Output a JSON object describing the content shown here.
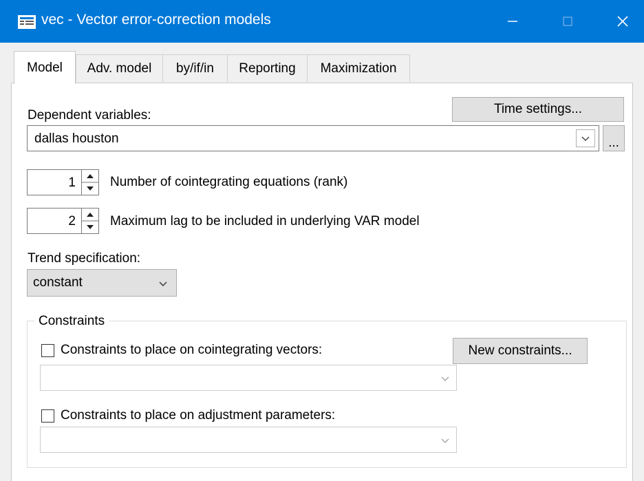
{
  "window": {
    "title": "vec - Vector error-correction models",
    "minimize_glyph": "—",
    "maximize_glyph": "☐",
    "close_glyph": "✕"
  },
  "tabs": [
    {
      "label": "Model",
      "active": true
    },
    {
      "label": "Adv. model",
      "active": false
    },
    {
      "label": "by/if/in",
      "active": false
    },
    {
      "label": "Reporting",
      "active": false
    },
    {
      "label": "Maximization",
      "active": false
    }
  ],
  "model": {
    "dependent_variables_label": "Dependent variables:",
    "dependent_variables_value": "dallas houston",
    "time_settings_button": "Time settings...",
    "browse_button": "...",
    "rank_value": "1",
    "rank_label": "Number of cointegrating equations (rank)",
    "lag_value": "2",
    "lag_label": "Maximum lag to be included in underlying VAR model",
    "trend_label": "Trend specification:",
    "trend_value": "constant",
    "constraints_group_label": "Constraints",
    "coint_constraints_label": "Constraints to place on cointegrating vectors:",
    "coint_constraints_checked": false,
    "new_constraints_button": "New constraints...",
    "adjust_constraints_label": "Constraints to place on adjustment parameters:",
    "adjust_constraints_checked": false
  },
  "colors": {
    "titlebar": "#0078d7",
    "window_bg": "#f0f0f0",
    "panel_bg": "#ffffff"
  },
  "icons": [
    "app-icon",
    "minimize-icon",
    "maximize-icon",
    "close-icon",
    "chevron-down-icon",
    "spin-up-icon",
    "spin-down-icon"
  ]
}
